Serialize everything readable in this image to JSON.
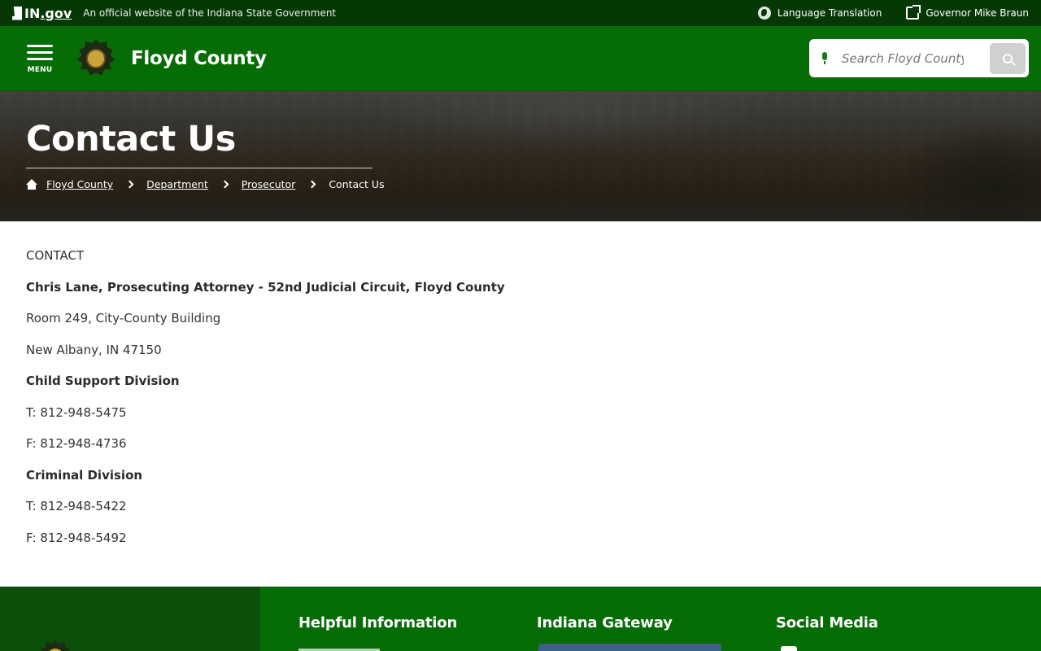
{
  "topbar": {
    "gov_logo": {
      "prefix": "IN",
      "suffix": ".gov"
    },
    "official_text": "An official website of the Indiana State Government",
    "language_translation": "Language Translation",
    "governor_link": "Governor Mike Braun"
  },
  "header": {
    "menu_label": "MENU",
    "site_name": "Floyd County",
    "search_placeholder": "Search Floyd County"
  },
  "hero": {
    "title": "Contact Us",
    "breadcrumbs": [
      "Floyd County",
      "Department",
      "Prosecutor"
    ],
    "current": "Contact Us"
  },
  "content": {
    "heading": "CONTACT",
    "attorney": "Chris Lane, Prosecuting Attorney - 52nd Judicial Circuit, Floyd County",
    "address_line1": "Room 249, City-County Building",
    "address_line2": "New Albany, IN 47150",
    "child_support": {
      "title": "Child Support Division",
      "phone": "T: 812-948-5475",
      "fax": "F: 812-948-4736"
    },
    "criminal": {
      "title": "Criminal Division",
      "phone": "T: 812-948-5422",
      "fax": "F: 812-948-5492"
    }
  },
  "footer": {
    "columns": [
      "Helpful Information",
      "Indiana Gateway",
      "Social Media"
    ]
  },
  "colors": {
    "topbar_bg": "#063806",
    "header_bg": "#066c06",
    "footer_left_bg": "#0b4f0b",
    "search_button_bg": "#d0d0d0"
  },
  "icons": [
    "in-state-icon",
    "globe-icon",
    "external-link-icon",
    "hamburger-menu-icon",
    "county-seal-icon",
    "microphone-icon",
    "search-icon",
    "home-icon",
    "chevron-right-icon",
    "facebook-icon"
  ]
}
